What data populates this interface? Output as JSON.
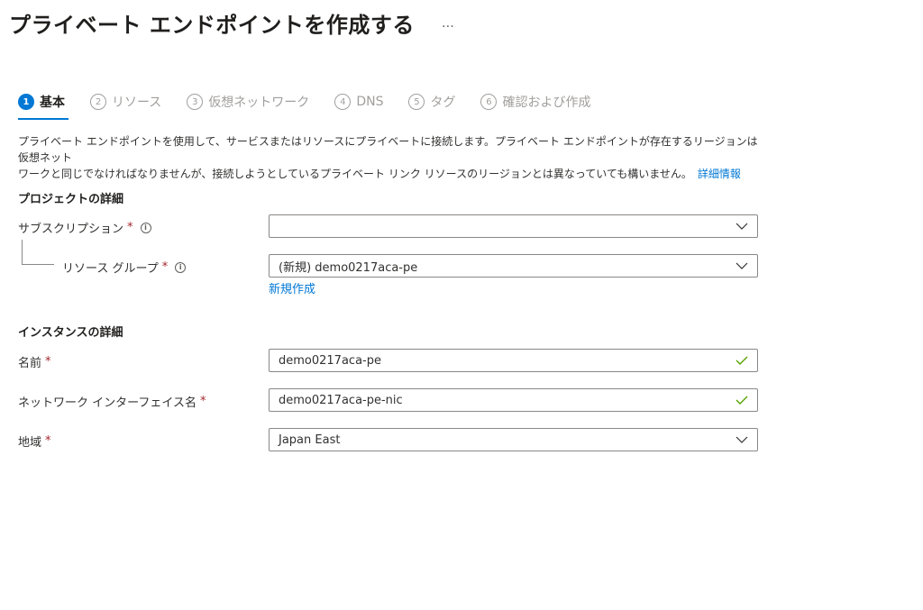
{
  "header": {
    "title": "プライベート エンドポイントを作成する",
    "more": "…"
  },
  "tabs": [
    {
      "num": "1",
      "label": "基本",
      "active": true
    },
    {
      "num": "2",
      "label": "リソース"
    },
    {
      "num": "3",
      "label": "仮想ネットワーク"
    },
    {
      "num": "4",
      "label": "DNS"
    },
    {
      "num": "5",
      "label": "タグ"
    },
    {
      "num": "6",
      "label": "確認および作成"
    }
  ],
  "description": {
    "line1": "プライベート エンドポイントを使用して、サービスまたはリソースにプライベートに接続します。プライベート エンドポイントが存在するリージョンは仮想ネット",
    "line2": "ワークと同じでなければなりませんが、接続しようとしているプライベート リンク リソースのリージョンとは異なっていても構いません。",
    "link": "詳細情報"
  },
  "project": {
    "section_title": "プロジェクトの詳細",
    "subscription_label": "サブスクリプション",
    "subscription_value": "",
    "resource_group_label": "リソース グループ",
    "resource_group_value": "(新規) demo0217aca-pe",
    "create_new": "新規作成"
  },
  "instance": {
    "section_title": "インスタンスの詳細",
    "name_label": "名前",
    "name_value": "demo0217aca-pe",
    "nic_label": "ネットワーク インターフェイス名",
    "nic_value": "demo0217aca-pe-nic",
    "region_label": "地域",
    "region_value": "Japan East"
  },
  "required_mark": "*",
  "info_glyph": "i",
  "colors": {
    "accent": "#0078d4",
    "required": "#a4262c",
    "valid": "#57a300"
  }
}
